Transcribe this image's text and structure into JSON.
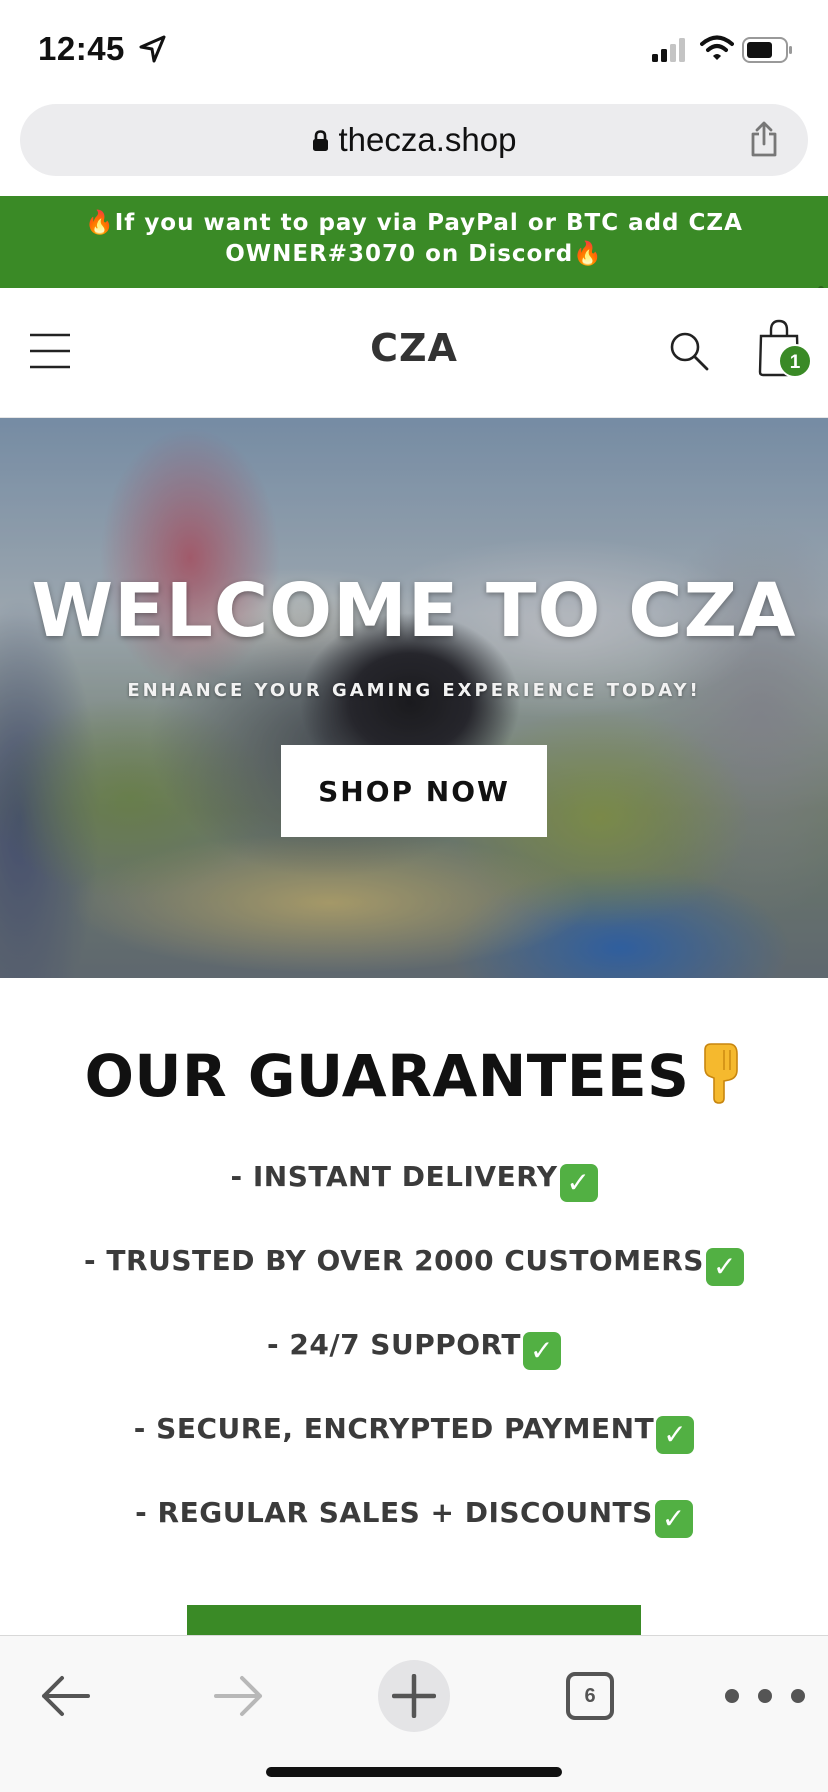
{
  "status_bar": {
    "time": "12:45",
    "icons": [
      "location-arrow-icon",
      "cellular-signal-icon",
      "wifi-icon",
      "battery-icon"
    ]
  },
  "browser": {
    "url": "thecza.shop",
    "share_icon": "share-icon",
    "lock_icon": "lock-icon"
  },
  "announcement": {
    "text": "🔥If you want to pay via PayPal or BTC add CZA OWNER#3070 on Discord🔥"
  },
  "header": {
    "logo": "CZA",
    "menu_icon": "hamburger-menu-icon",
    "search_icon": "search-icon",
    "cart_icon": "shopping-bag-icon",
    "cart_count": "1"
  },
  "hero": {
    "title": "WELCOME TO CZA",
    "subtitle": "ENHANCE YOUR GAMING EXPERIENCE TODAY!",
    "button_label": "SHOP NOW"
  },
  "guarantees": {
    "title": "OUR GUARANTEES",
    "title_icon": "pointing-down-hand-icon",
    "items": [
      "- INSTANT DELIVERY",
      "- TRUSTED BY OVER 2000 CUSTOMERS",
      "- 24/7 SUPPORT",
      "- SECURE, ENCRYPTED PAYMENT",
      "- REGULAR SALES + DISCOUNTS"
    ],
    "check_glyph": "✓"
  },
  "toolbar": {
    "back_icon": "back-arrow-icon",
    "forward_icon": "forward-arrow-icon",
    "new_tab_icon": "plus-icon",
    "tab_count": "6",
    "more_icon": "more-dots-icon"
  },
  "colors": {
    "brand_green": "#3a8a26",
    "check_green": "#52b043"
  }
}
